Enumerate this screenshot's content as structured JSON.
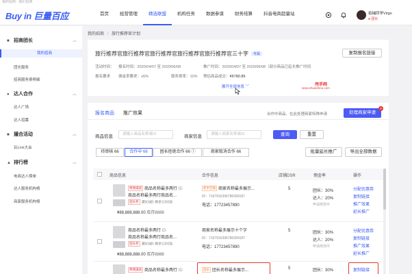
{
  "top_strip": "我的招商 - 我们招商",
  "header": {
    "logo_text": "Buy in 巨量百应",
    "nav": [
      "首页",
      "经营管理",
      "精选联盟",
      "机构任务",
      "数据参谋",
      "财务结算",
      "抖音电商超量站"
    ],
    "active_nav": "精选联盟",
    "user_name": "拾捕同学Virgo",
    "user_role": "● 团长"
  },
  "sidebar": {
    "groups": [
      {
        "label": "招商团长",
        "icon": "■",
        "items": [
          "我的招商",
          "团长服务",
          "招商服务费明细"
        ]
      },
      {
        "label": "达人合作",
        "icon": "●",
        "items": [
          "达人广场",
          "达人招募"
        ]
      },
      {
        "label": "撮合活动",
        "icon": "■",
        "items": [
          "玩Link大会"
        ]
      },
      {
        "label": "排行榜",
        "icon": "▲",
        "items": [
          "电商达人榜单",
          "达人服务机构榜",
          "商家服务机构榜"
        ]
      }
    ],
    "active_item": "我的招商"
  },
  "breadcrumb": {
    "parent": "我的招商",
    "separator": "/",
    "current": "旅行推荐官计划"
  },
  "plan": {
    "title": "旅行推荐官旅行推荐官旅行推荐官旅行推荐官旅行推荐官三十字",
    "tag": "专属",
    "copy_link_button": "复制报名链接",
    "activity_time": "活动时间：",
    "signup_time": "报名时间：2020/04/07 至 2020/06/08",
    "promo_time": "推广时间：2020/04/07 至 2020/06/08（部分商品已延长推广时间",
    "requirement": "报名要求",
    "commission_req": "佣金率要求：≥5%",
    "service_fee": "服务费率：10%",
    "expected_gmv": "预估商品成交：",
    "expected_gmv_value": "¥6780.89",
    "expand_all": "展开全部信息",
    "watermark": "甩手网",
    "watermark_url": "www.shuaishou.com"
  },
  "tabs": {
    "items": [
      "报名商品",
      "推广效果"
    ],
    "active": "报名商品",
    "notice": "合作中商品、在此处理商家特殊申请",
    "process_button": "处理商家申请",
    "badge": "8"
  },
  "filters": {
    "product_label": "商品信息",
    "product_placeholder": "请输入商品名称或ID",
    "merchant_label": "商家信息",
    "merchant_placeholder": "请输入商家名称或ID",
    "search_button": "查询",
    "reset_button": "重置"
  },
  "status_tabs": [
    {
      "label": "待审核 66",
      "active": false
    },
    {
      "label": "合作中 66",
      "active": true
    },
    {
      "label": "团长拒绝合作 66 ⓘ",
      "active": false
    },
    {
      "label": "商家取消合作 66",
      "active": false
    }
  ],
  "batch_extend_button": "批量延长推广",
  "export_button": "导出全部数据",
  "table": {
    "headers": [
      "商品信息",
      "合作信息",
      "店铺DSR",
      "佣金率",
      "操作"
    ],
    "rows": [
      {
        "product_tag": "降佣满减",
        "product_line1": "商品名称最多两行",
        "product_id": "ID",
        "product_line2": "商品名称最多两行商品名...",
        "coupon_tag": "团长券",
        "coupon_text": "满50减5",
        "stock_left": "剩余1000张",
        "price": "¥88,888,888.00",
        "stock": "库存8888",
        "coop_tag": "新手店铺",
        "coop_name": "商家名称最多展示...",
        "coop_id": "ID：7197916396786390187",
        "coop_phone": "电话：17723457890",
        "dsr": "5",
        "commission_label": "团长：",
        "commission_value": "30%",
        "commission_author": "达人：",
        "commission_author_value": "20%",
        "commission_note": "申请修改中",
        "ops": [
          "分配优惠券",
          "复制链接",
          "推广效果",
          "延长推广"
        ]
      },
      {
        "product_tag": "",
        "product_line1": "商品名称最多两行",
        "product_id": "ID",
        "product_line2": "商品名称最多两行商品名...",
        "coupon_tag": "团长券",
        "coupon_text": "满50减5",
        "stock_left": "剩余1000张",
        "price": "¥88,888,888.00",
        "stock": "库存8888",
        "coop_tag": "",
        "coop_name": "商家名称最多展示十个字",
        "coop_id": "ID：7197916396786390187",
        "coop_phone": "电话：17723457890",
        "dsr": "5",
        "commission_label": "团长：",
        "commission_value": "30%",
        "commission_author": "达人：",
        "commission_author_value": "20%",
        "commission_note": "申请修改中",
        "ops": [
          "分配优惠券",
          "复制链接",
          "推广效果",
          "延长推广"
        ]
      },
      {
        "product_tag": "降佣满减",
        "product_line1": "商品名称最多两行",
        "product_id": "ID",
        "coop_tag": "团长",
        "coop_name": "团长名称最多展示...",
        "dsr": "5",
        "commission_label": "团长：",
        "commission_value": "30%",
        "ops": [
          "复制链接"
        ]
      }
    ]
  }
}
